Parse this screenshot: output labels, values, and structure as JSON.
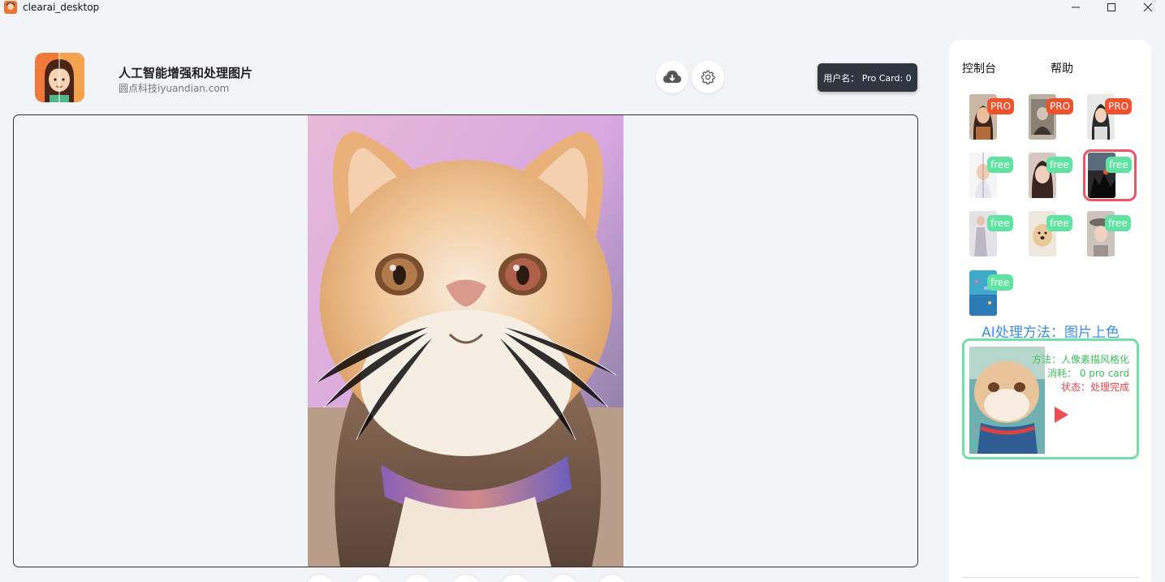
{
  "window": {
    "title": "clearai_desktop"
  },
  "header": {
    "app_name": "人工智能增强和处理图片",
    "subtitle": "圆点科技iyuandian.com",
    "user_badge": "用户名： Pro Card: 0"
  },
  "panel": {
    "tabs": {
      "console": "控制台",
      "help": "帮助"
    },
    "tools": [
      {
        "tag": "PRO",
        "kind": "pro",
        "icon": "portrait-woman-thumb"
      },
      {
        "tag": "PRO",
        "kind": "pro",
        "icon": "old-photo-thumb"
      },
      {
        "tag": "PRO",
        "kind": "pro",
        "icon": "portrait-split-thumb"
      },
      {
        "tag": "free",
        "kind": "free",
        "icon": "sketch-portrait-thumb"
      },
      {
        "tag": "free",
        "kind": "free",
        "icon": "face-retouch-thumb"
      },
      {
        "tag": "free",
        "kind": "free",
        "icon": "colorize-thumb",
        "selected": true
      },
      {
        "tag": "free",
        "kind": "free",
        "icon": "fullbody-thumb"
      },
      {
        "tag": "free",
        "kind": "free",
        "icon": "dog-thumb"
      },
      {
        "tag": "free",
        "kind": "free",
        "icon": "woman-hat-thumb"
      },
      {
        "tag": "free",
        "kind": "free",
        "icon": "anime-thumb"
      }
    ],
    "method_title": "AI处理方法：图片上色",
    "method_card": {
      "method": "方法：人像素描风格化",
      "cost": "消耗： 0 pro card",
      "status": "状态：处理完成"
    }
  },
  "colors": {
    "pro_tag": "#f0532c",
    "free_tag": "#5fe3a1",
    "selected_outline": "#ef5560",
    "method_title": "#3b8fe0",
    "card_border": "#6ee0a8",
    "status_red": "#ec4444",
    "info_green": "#3cbf5a"
  }
}
